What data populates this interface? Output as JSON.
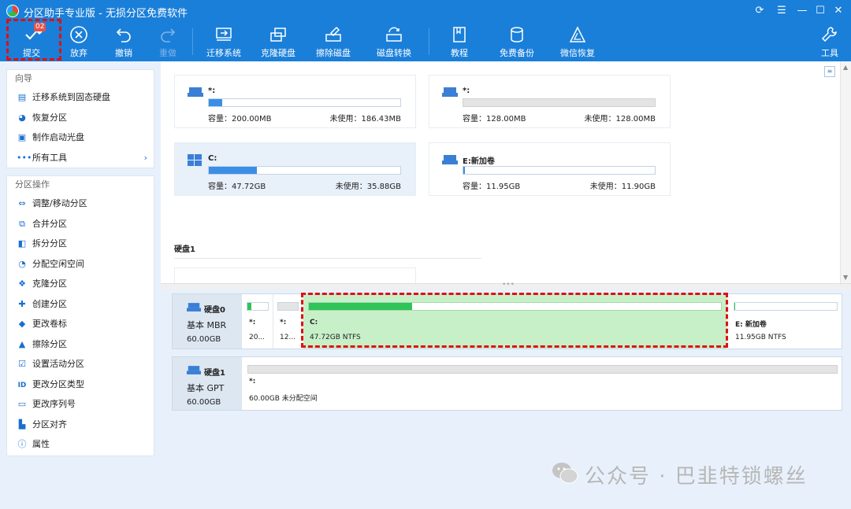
{
  "window": {
    "title": "分区助手专业版 - 无损分区免费软件",
    "controls": [
      "refresh-icon",
      "menu-icon",
      "minimize-icon",
      "maximize-icon",
      "close-icon"
    ]
  },
  "toolbar": {
    "commit": {
      "label": "提交",
      "badge": "02"
    },
    "discard": "放弃",
    "undo": "撤销",
    "redo": "重做",
    "migrate": "迁移系统",
    "clone": "克隆硬盘",
    "wipe": "擦除磁盘",
    "convert": "磁盘转换",
    "tutorial": "教程",
    "backup": "免费备份",
    "wechat_restore": "微信恢复",
    "tools": "工具"
  },
  "sidebar": {
    "guide_title": "向导",
    "guide_items": [
      {
        "label": "迁移系统到固态硬盘",
        "icon": "migrate-icon"
      },
      {
        "label": "恢复分区",
        "icon": "recover-icon"
      },
      {
        "label": "制作启动光盘",
        "icon": "bootdisk-icon"
      },
      {
        "label": "所有工具",
        "icon": "more-icon"
      }
    ],
    "ops_title": "分区操作",
    "ops_items": [
      {
        "label": "调整/移动分区",
        "icon": "resize-icon"
      },
      {
        "label": "合并分区",
        "icon": "merge-icon"
      },
      {
        "label": "拆分分区",
        "icon": "split-icon"
      },
      {
        "label": "分配空闲空间",
        "icon": "allocate-icon"
      },
      {
        "label": "克隆分区",
        "icon": "clone-icon"
      },
      {
        "label": "创建分区",
        "icon": "create-icon"
      },
      {
        "label": "更改卷标",
        "icon": "label-icon"
      },
      {
        "label": "擦除分区",
        "icon": "wipe-icon"
      },
      {
        "label": "设置活动分区",
        "icon": "active-icon"
      },
      {
        "label": "更改分区类型",
        "icon": "id-icon"
      },
      {
        "label": "更改序列号",
        "icon": "serial-icon"
      },
      {
        "label": "分区对齐",
        "icon": "align-icon"
      },
      {
        "label": "属性",
        "icon": "info-icon"
      }
    ]
  },
  "partitions": [
    {
      "name": "*:",
      "capacity": "容量：200.00MB",
      "free": "未使用：186.43MB",
      "used_fraction": 0.07
    },
    {
      "name": "*:",
      "capacity": "容量：128.00MB",
      "free": "未使用：128.00MB",
      "used_fraction": 0.0
    },
    {
      "name": "C:",
      "capacity": "容量：47.72GB",
      "free": "未使用：35.88GB",
      "used_fraction": 0.25
    },
    {
      "name": "E:新加卷",
      "capacity": "容量：11.95GB",
      "free": "未使用：11.90GB",
      "used_fraction": 0.004
    }
  ],
  "disk1_heading": "硬盘1",
  "diskmap": {
    "disk0": {
      "name": "硬盘0",
      "type": "基本 MBR",
      "size": "60.00GB",
      "parts": [
        {
          "name": "*:",
          "info": "20...",
          "used_fraction": 0.07
        },
        {
          "name": "*:",
          "info": "12...",
          "used_fraction": 0.0
        },
        {
          "name": "C:",
          "info": "47.72GB NTFS",
          "used_fraction": 0.25
        },
        {
          "name": "E: 新加卷",
          "info": "11.95GB NTFS",
          "used_fraction": 0.004
        }
      ]
    },
    "disk1": {
      "name": "硬盘1",
      "type": "基本 GPT",
      "size": "60.00GB",
      "parts": [
        {
          "name": "*:",
          "info": "60.00GB 未分配空间",
          "used_fraction": 0.0
        }
      ]
    }
  },
  "watermark": "公众号 · 巴韭特锁螺丝",
  "colors": {
    "accent": "#1a7fd9",
    "used_bar": "#3a8ee6",
    "selected_part": "#c7f0c9",
    "highlight": "#e01010"
  }
}
